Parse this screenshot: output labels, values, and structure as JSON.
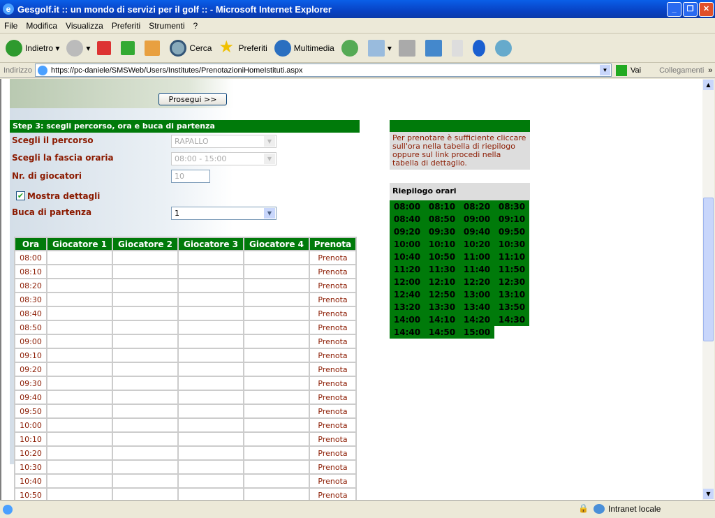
{
  "window": {
    "title": "Gesgolf.it :: un mondo di servizi per il golf :: - Microsoft Internet Explorer"
  },
  "menu": [
    "File",
    "Modifica",
    "Visualizza",
    "Preferiti",
    "Strumenti",
    "?"
  ],
  "toolbar": {
    "back": "Indietro",
    "search": "Cerca",
    "favorites": "Preferiti",
    "media": "Multimedia"
  },
  "address": {
    "label": "Indirizzo",
    "url": "https://pc-daniele/SMSWeb/Users/Institutes/PrenotazioniHomeIstituti.aspx",
    "go": "Vai",
    "links": "Collegamenti"
  },
  "status": {
    "zone": "Intranet locale"
  },
  "form": {
    "continue_button": "Prosegui >>",
    "step_title": "Step 3: scegli percorso, ora e buca di partenza",
    "course_label": "Scegli il percorso",
    "course_value": "RAPALLO",
    "slot_label": "Scegli la fascia oraria",
    "slot_value": "08:00 - 15:00",
    "players_label": "Nr. di giocatori",
    "players_value": "10",
    "details_label": "Mostra dettagli",
    "details_checked": true,
    "hole_label": "Buca di partenza",
    "hole_value": "1"
  },
  "detail_table": {
    "headers": [
      "Ora",
      "Giocatore 1",
      "Giocatore 2",
      "Giocatore 3",
      "Giocatore 4",
      "Prenota"
    ],
    "link_label": "Prenota",
    "times": [
      "08:00",
      "08:10",
      "08:20",
      "08:30",
      "08:40",
      "08:50",
      "09:00",
      "09:10",
      "09:20",
      "09:30",
      "09:40",
      "09:50",
      "10:00",
      "10:10",
      "10:20",
      "10:30",
      "10:40",
      "10:50"
    ]
  },
  "info": {
    "text": "Per prenotare è sufficiente cliccare sull'ora nella tabella di riepilogo oppure sul link procedi nella tabella di dettaglio."
  },
  "summary": {
    "title": "Riepilogo orari",
    "times": [
      "08:00",
      "08:10",
      "08:20",
      "08:30",
      "08:40",
      "08:50",
      "09:00",
      "09:10",
      "09:20",
      "09:30",
      "09:40",
      "09:50",
      "10:00",
      "10:10",
      "10:20",
      "10:30",
      "10:40",
      "10:50",
      "11:00",
      "11:10",
      "11:20",
      "11:30",
      "11:40",
      "11:50",
      "12:00",
      "12:10",
      "12:20",
      "12:30",
      "12:40",
      "12:50",
      "13:00",
      "13:10",
      "13:20",
      "13:30",
      "13:40",
      "13:50",
      "14:00",
      "14:10",
      "14:20",
      "14:30",
      "14:40",
      "14:50",
      "15:00"
    ]
  },
  "colors": {
    "green": "#007a0a",
    "label": "#8b1a00"
  }
}
